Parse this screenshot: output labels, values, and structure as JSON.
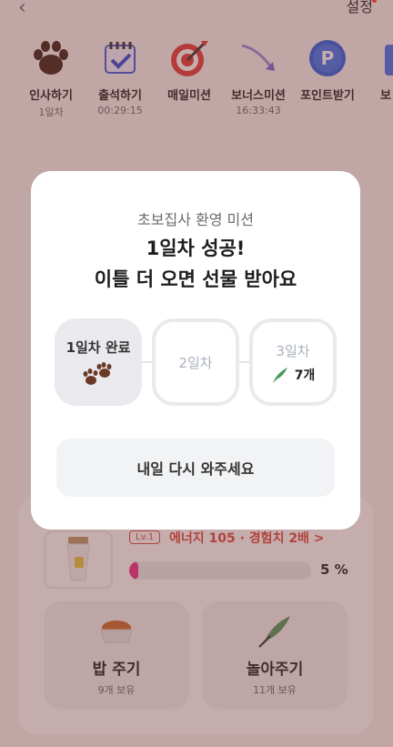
{
  "header": {
    "settings_label": "설정"
  },
  "missions": [
    {
      "label": "인사하기",
      "sub": "1일차",
      "icon": "paw-icon"
    },
    {
      "label": "출석하기",
      "sub": "00:29:15",
      "icon": "calendar-check-icon"
    },
    {
      "label": "매일미션",
      "sub": "",
      "icon": "target-icon"
    },
    {
      "label": "보너스미션",
      "sub": "16:33:43",
      "icon": "arrow-bonus-icon"
    },
    {
      "label": "포인트받기",
      "sub": "",
      "icon": "point-coin-icon"
    },
    {
      "label": "보",
      "sub": "",
      "icon": "partial-icon"
    }
  ],
  "pet": {
    "level": "Lv.1",
    "energy_text": "에너지 105 · 경험치 2배 >",
    "progress": 5,
    "progress_text": "5 %",
    "feed_label": "밥 주기",
    "feed_sub": "9개 보유",
    "play_label": "놀아주기",
    "play_sub": "11개 보유"
  },
  "modal": {
    "subtitle": "초보집사 환영 미션",
    "title_line1": "1일차 성공!",
    "title_line2": "이틀 더 오면 선물 받아요",
    "days": [
      {
        "label": "1일차 완료",
        "status": "done"
      },
      {
        "label": "2일차",
        "status": "todo"
      },
      {
        "label": "3일차",
        "status": "todo",
        "reward_count": "7개"
      }
    ],
    "cta_label": "내일 다시 와주세요"
  },
  "colors": {
    "accent_pink": "#e8308a",
    "accent_red": "#d94b3d",
    "overlay": "#7a3c3c"
  }
}
